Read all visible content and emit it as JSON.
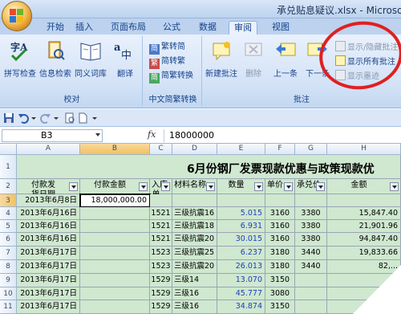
{
  "window": {
    "title": "承兑贴息疑议.xlsx - Microsoft"
  },
  "ribbon_tabs": [
    "开始",
    "插入",
    "页面布局",
    "公式",
    "数据",
    "审阅",
    "视图"
  ],
  "active_tab": "审阅",
  "groups": {
    "proofing": {
      "label": "校对",
      "buttons": [
        "拼写检查",
        "信息检索",
        "同义词库",
        "翻译"
      ]
    },
    "chinese_conversion": {
      "label": "中文简繁转换",
      "buttons": [
        "繁转简",
        "简转繁",
        "简繁转换"
      ]
    },
    "comments": {
      "label": "批注",
      "buttons": [
        "新建批注",
        "删除",
        "上一条",
        "下一条"
      ],
      "side_buttons": [
        "显示/隐藏批注",
        "显示所有批注",
        "显示墨迹"
      ]
    }
  },
  "formula_bar": {
    "name_box": "B3",
    "fx": "fx",
    "value": "18000000"
  },
  "columns": [
    "A",
    "B",
    "C",
    "D",
    "E",
    "F",
    "G",
    "H"
  ],
  "rows": [
    "1",
    "2",
    "3",
    "4",
    "5",
    "6",
    "7",
    "8",
    "9",
    "10",
    "11"
  ],
  "sheet_title": "6月份钢厂发票现款优惠与政策现款优",
  "headers": {
    "a": "付款发\n货日期",
    "b": "付款金额",
    "c": "入库\n单",
    "d": "材料名称",
    "e": "数量",
    "f": "单价",
    "g": "承兑价",
    "h": "金额"
  },
  "table_rows": [
    {
      "date": "2013年6月8日",
      "amount": "18,000,000.00",
      "entry": "",
      "material": "",
      "qty": "",
      "price": "",
      "accept": "",
      "total": ""
    },
    {
      "date": "2013年6月16日",
      "amount": "",
      "entry": "1521",
      "material": "三级抗震16",
      "qty": "5.015",
      "price": "3160",
      "accept": "3380",
      "total": "15,847.40"
    },
    {
      "date": "2013年6月16日",
      "amount": "",
      "entry": "1521",
      "material": "三级抗震18",
      "qty": "6.931",
      "price": "3160",
      "accept": "3380",
      "total": "21,901.96"
    },
    {
      "date": "2013年6月16日",
      "amount": "",
      "entry": "1521",
      "material": "三级抗震20",
      "qty": "30.015",
      "price": "3160",
      "accept": "3380",
      "total": "94,847.40"
    },
    {
      "date": "2013年6月17日",
      "amount": "",
      "entry": "1523",
      "material": "三级抗震25",
      "qty": "6.237",
      "price": "3180",
      "accept": "3440",
      "total": "19,833.66"
    },
    {
      "date": "2013年6月17日",
      "amount": "",
      "entry": "1523",
      "material": "三级抗震20",
      "qty": "26.013",
      "price": "3180",
      "accept": "3440",
      "total": "82,..."
    },
    {
      "date": "2013年6月17日",
      "amount": "",
      "entry": "1529",
      "material": "三级14",
      "qty": "13.070",
      "price": "3150",
      "accept": "",
      "total": ""
    },
    {
      "date": "2013年6月17日",
      "amount": "",
      "entry": "1529",
      "material": "三级16",
      "qty": "45.777",
      "price": "3080",
      "accept": "",
      "total": ""
    },
    {
      "date": "2013年6月17日",
      "amount": "",
      "entry": "1529",
      "material": "三级16",
      "qty": "34.874",
      "price": "3150",
      "accept": "",
      "total": ""
    }
  ],
  "colors": {
    "cell_fill": "#cfe8cf",
    "annotation": "#e02020",
    "ribbon_bg": "#d3e2f6"
  }
}
